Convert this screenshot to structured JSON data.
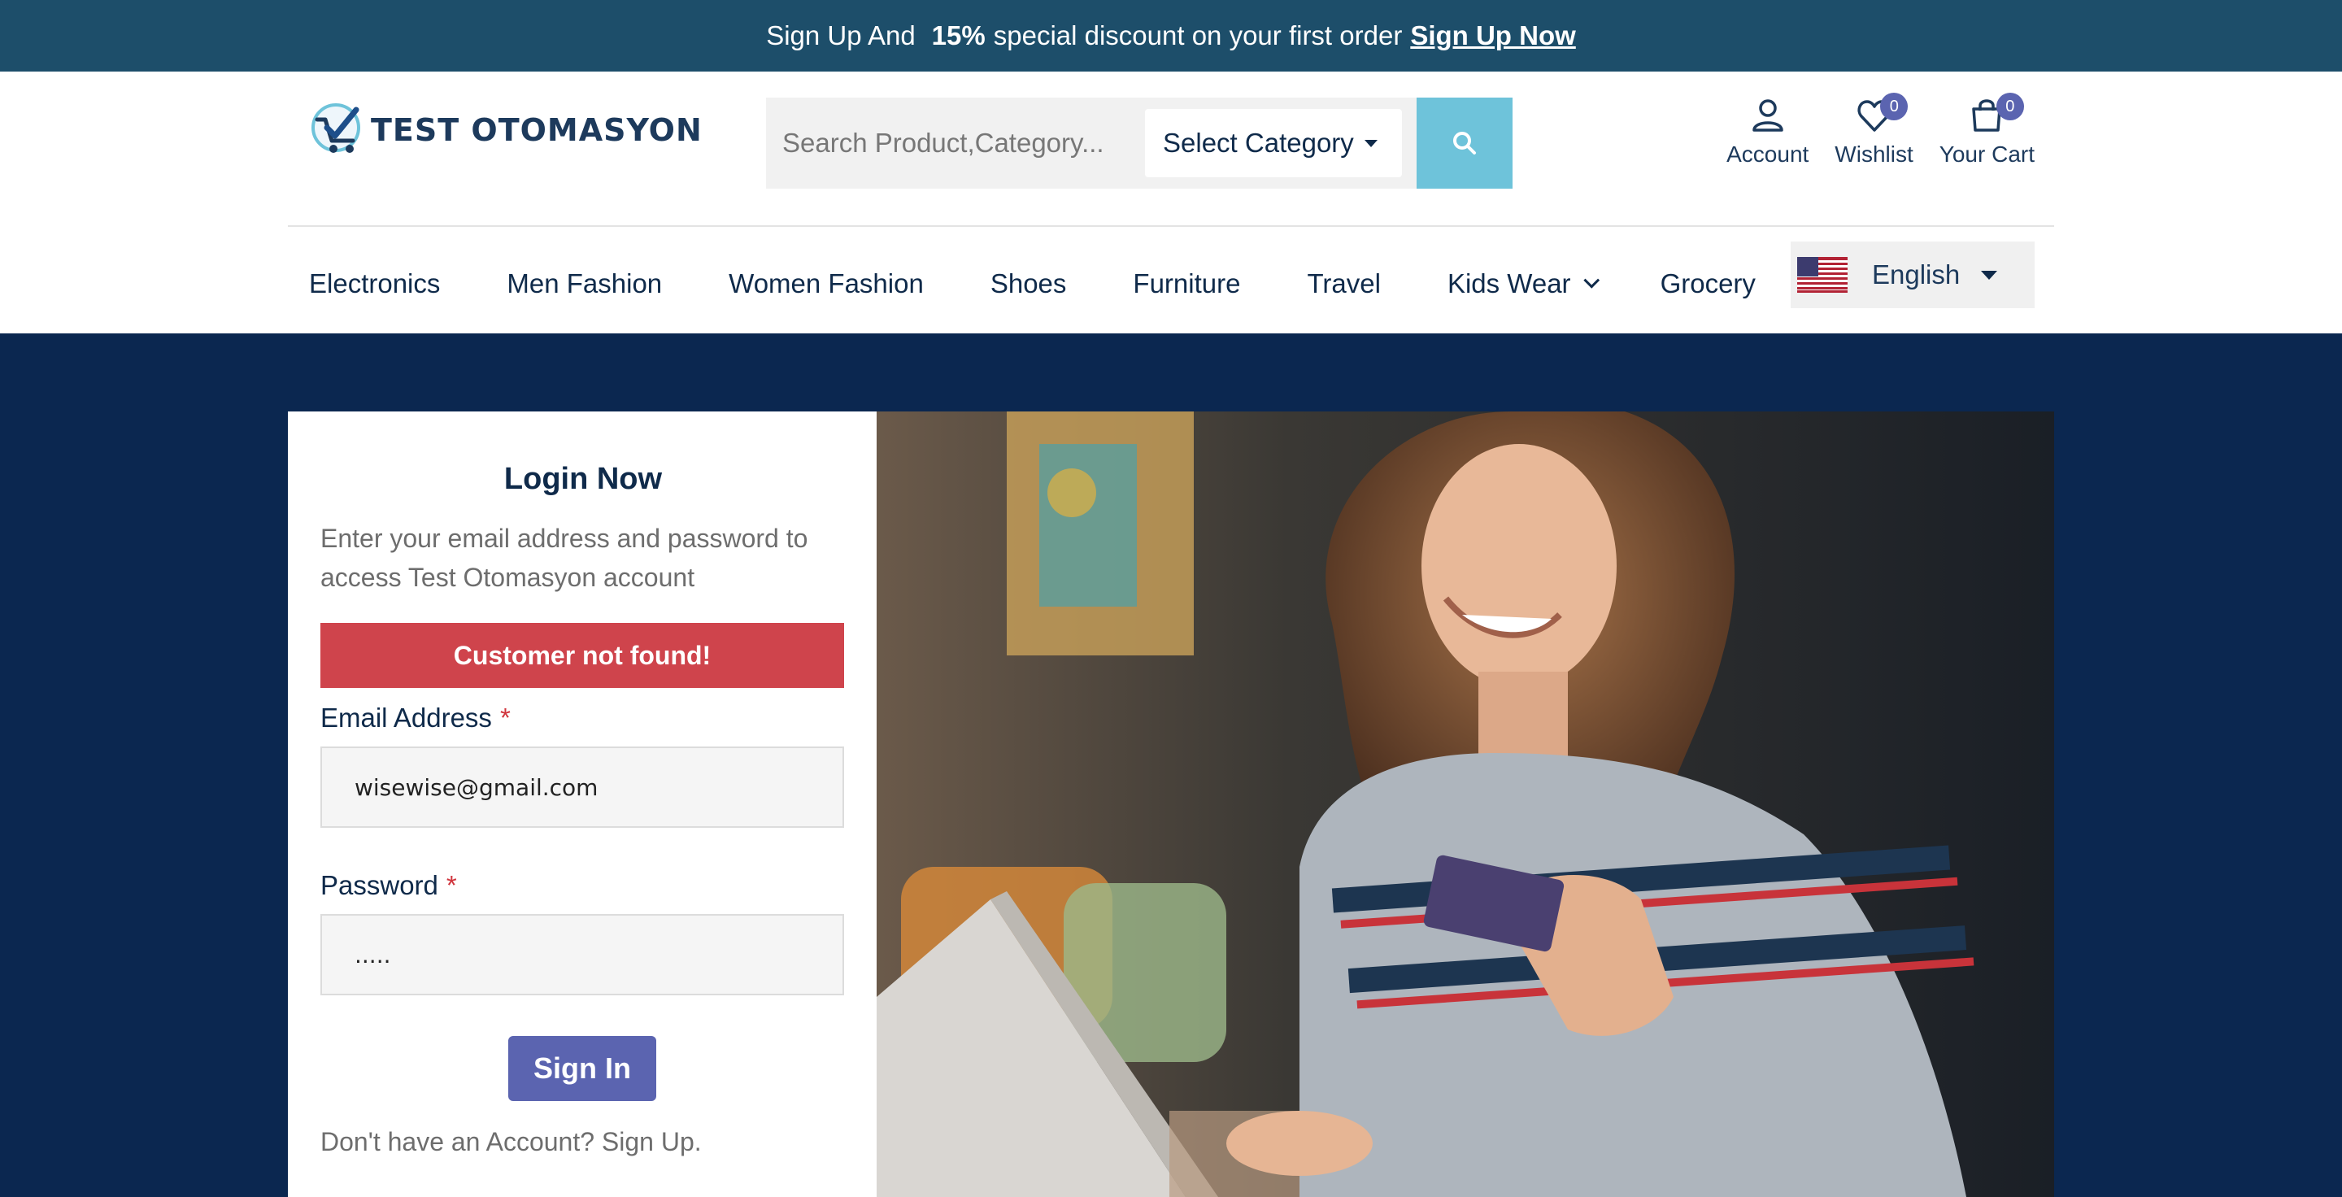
{
  "promo": {
    "text_before": "Sign Up And",
    "discount": "15%",
    "text_after": "special discount on your first order",
    "link": "Sign Up Now"
  },
  "header": {
    "logo_text": "TEST OTOMASYON",
    "search": {
      "placeholder": "Search Product,Category...",
      "value": ""
    },
    "category_select": "Select Category",
    "icons": {
      "account": {
        "label": "Account",
        "icon": "user-icon"
      },
      "wishlist": {
        "label": "Wishlist",
        "count": "0",
        "icon": "heart-icon"
      },
      "cart": {
        "label": "Your Cart",
        "count": "0",
        "icon": "bag-icon"
      }
    }
  },
  "nav": {
    "items": [
      "Electronics",
      "Men Fashion",
      "Women Fashion",
      "Shoes",
      "Furniture",
      "Travel",
      "Kids Wear",
      "Grocery"
    ],
    "language": "English"
  },
  "login": {
    "title": "Login Now",
    "description": "Enter your email address and password to access Test Otomasyon account",
    "alert": "Customer not found!",
    "email_label": "Email Address",
    "email_value": "wisewise@gmail.com",
    "password_label": "Password",
    "password_value": ".....",
    "required_mark": "*",
    "signin_button": "Sign In",
    "signup_prompt": "Don't have an Account?",
    "signup_link": "Sign Up."
  },
  "colors": {
    "promo_bg": "#1d4e6a",
    "main_bg": "#0b2750",
    "accent": "#5b64b0",
    "alert": "#cf444c",
    "search_button": "#6ec3da"
  }
}
